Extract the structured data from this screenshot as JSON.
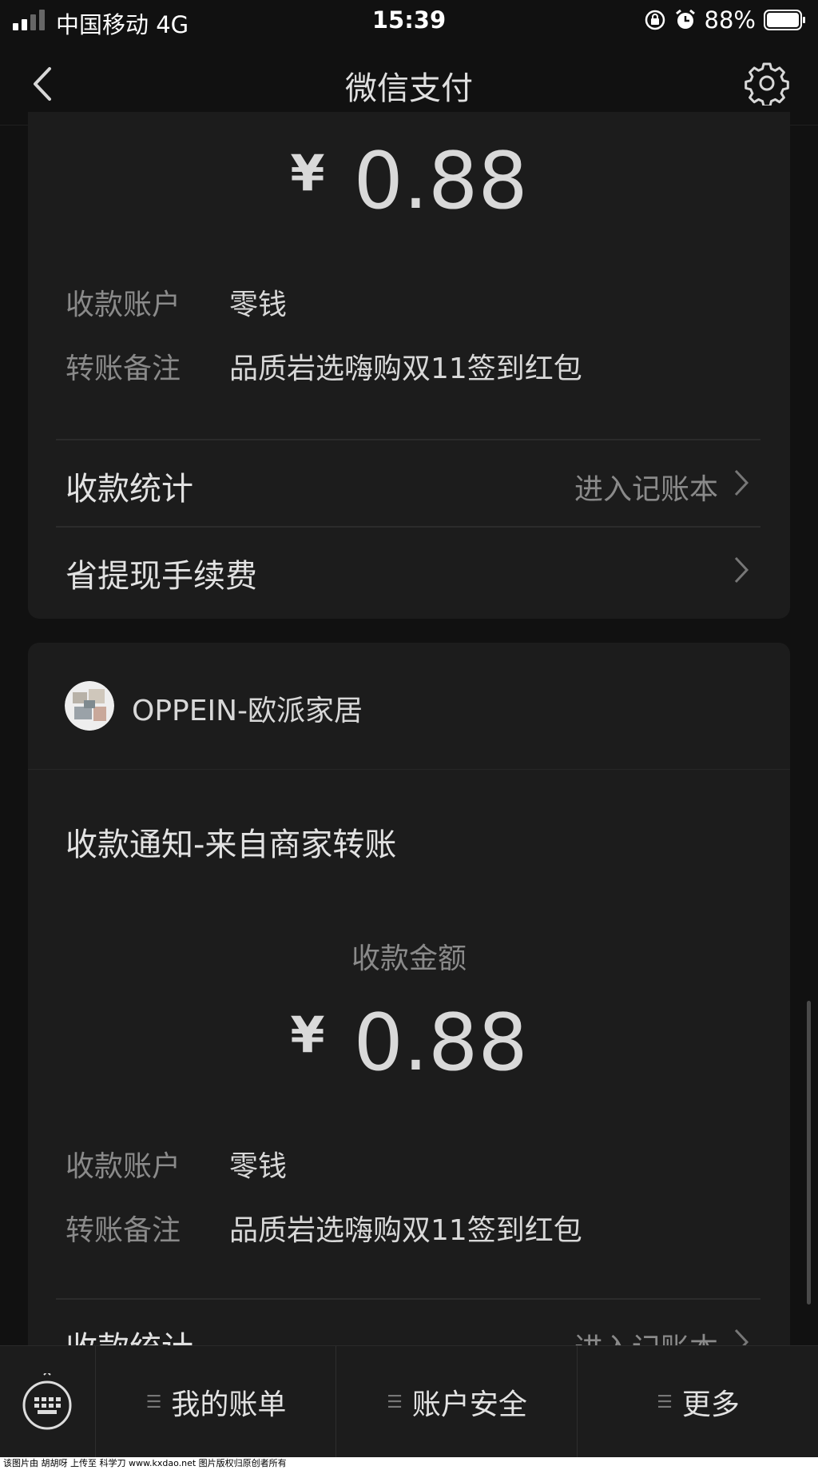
{
  "status_bar": {
    "carrier": "中国移动  4G",
    "time": "15:39",
    "battery": "88%",
    "battery_level": 0.88,
    "icons": [
      "signal-icon",
      "orientation-lock-icon",
      "alarm-icon",
      "battery-icon"
    ]
  },
  "nav": {
    "title": "微信支付",
    "icons": [
      "back-icon",
      "gear-icon"
    ]
  },
  "card1": {
    "currency": "¥",
    "amount": "0.88",
    "details": [
      {
        "label": "收款账户",
        "value": "零钱"
      },
      {
        "label": "转账备注",
        "value": "品质岩选嗨购双11签到红包"
      }
    ],
    "stats_label": "收款统计",
    "stats_link": "进入记账本",
    "fee_label": "省提现手续费"
  },
  "card2": {
    "merchant_name": "OPPEIN-欧派家居",
    "notice_title": "收款通知-来自商家转账",
    "amount_label": "收款金额",
    "currency": "¥",
    "amount": "0.88",
    "details": [
      {
        "label": "收款账户",
        "value": "零钱"
      },
      {
        "label": "转账备注",
        "value": "品质岩选嗨购双11签到红包"
      }
    ],
    "stats_label": "收款统计",
    "stats_link": "进入记账本"
  },
  "bottom_menu": {
    "items": [
      {
        "label": "我的账单"
      },
      {
        "label": "账户安全"
      },
      {
        "label": "更多"
      }
    ],
    "keyboard_icon": "keyboard-icon"
  },
  "footer_text": "该图片由 胡胡呀 上传至 科学刀 www.kxdao.net 图片版权归原创者所有",
  "colors": {
    "background": "#111111",
    "card": "#1c1c1c",
    "label": "#8a8a8a",
    "text": "#e2e2e2"
  }
}
